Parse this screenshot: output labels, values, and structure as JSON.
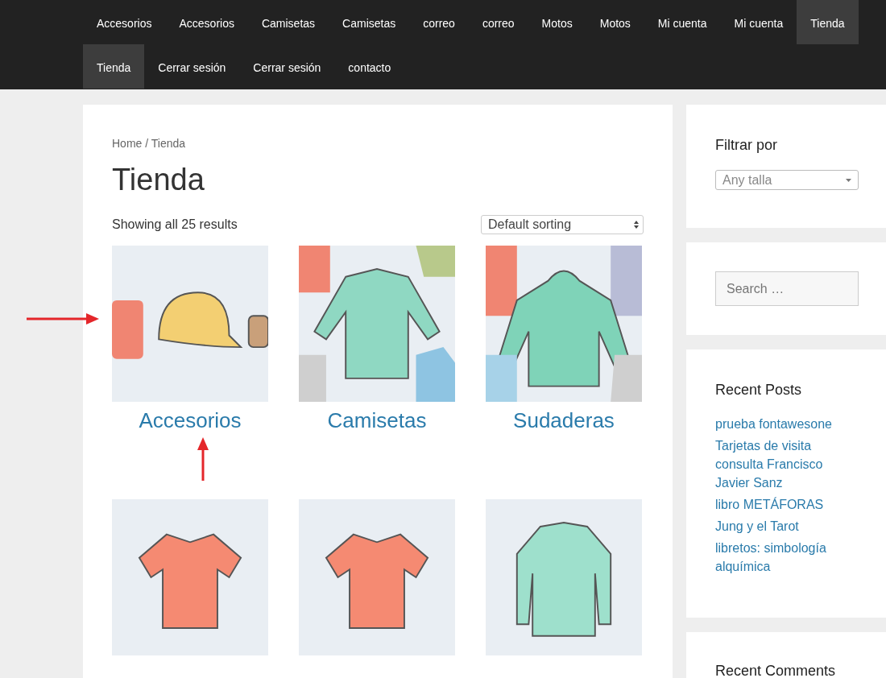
{
  "nav": [
    {
      "label": "Accesorios",
      "selected": false
    },
    {
      "label": "Accesorios",
      "selected": false
    },
    {
      "label": "Camisetas",
      "selected": false
    },
    {
      "label": "Camisetas",
      "selected": false
    },
    {
      "label": "correo",
      "selected": false
    },
    {
      "label": "correo",
      "selected": false
    },
    {
      "label": "Motos",
      "selected": false
    },
    {
      "label": "Motos",
      "selected": false
    },
    {
      "label": "Mi cuenta",
      "selected": false
    },
    {
      "label": "Mi cuenta",
      "selected": false
    },
    {
      "label": "Tienda",
      "selected": true
    },
    {
      "label": "Tienda",
      "selected": true
    },
    {
      "label": "Cerrar sesión",
      "selected": false
    },
    {
      "label": "Cerrar sesión",
      "selected": false
    },
    {
      "label": "contacto",
      "selected": false
    }
  ],
  "breadcrumb": "Home / Tienda",
  "title": "Tienda",
  "result_count": "Showing all 25 results",
  "sorting": {
    "value": "Default sorting"
  },
  "products": [
    {
      "kind": "accessories",
      "title": "Accesorios"
    },
    {
      "kind": "shirts",
      "title": "Camisetas"
    },
    {
      "kind": "hoodies",
      "title": "Sudaderas"
    },
    {
      "kind": "tshirt"
    },
    {
      "kind": "tshirt"
    },
    {
      "kind": "sweater"
    }
  ],
  "annotations": [
    {
      "kind": "right"
    },
    {
      "kind": "up"
    }
  ],
  "sidebar": {
    "filter": {
      "title": "Filtrar por",
      "value": "Any talla"
    },
    "search": {
      "placeholder": "Search …"
    },
    "recent_posts": {
      "title": "Recent Posts",
      "items": [
        "prueba fontawesone",
        "Tarjetas de visita consulta Francisco Javier Sanz",
        "libro METÁFORAS",
        "Jung y el Tarot",
        "libretos: simbología alquímica"
      ]
    },
    "recent_comments": {
      "title": "Recent Comments"
    }
  }
}
